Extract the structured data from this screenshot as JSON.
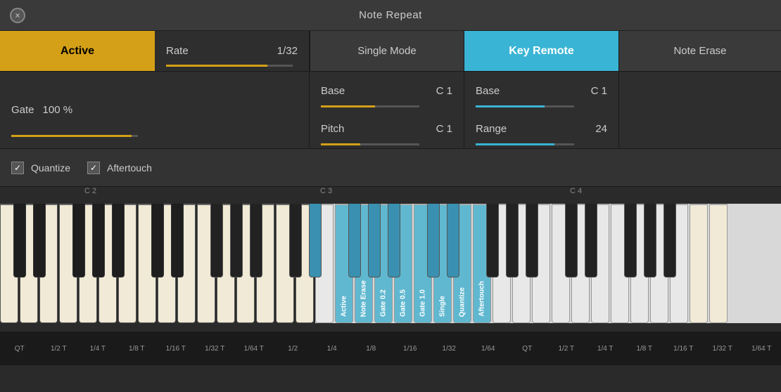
{
  "titleBar": {
    "title": "Note Repeat",
    "close": "×"
  },
  "controls": {
    "active": "Active",
    "rate_label": "Rate",
    "rate_value": "1/32",
    "single_mode": "Single Mode",
    "key_remote": "Key Remote",
    "note_erase": "Note Erase"
  },
  "params": {
    "gate_label": "Gate",
    "gate_value": "100 %",
    "single_mode": {
      "base_label": "Base",
      "base_value": "C 1",
      "pitch_label": "Pitch",
      "pitch_value": "C 1"
    },
    "key_remote": {
      "base_label": "Base",
      "base_value": "C 1",
      "range_label": "Range",
      "range_value": "24"
    }
  },
  "checkboxes": {
    "quantize": "Quantize",
    "aftertouch": "Aftertouch"
  },
  "noteLabels": {
    "c2": "C 2",
    "c3": "C 3",
    "c4": "C 4"
  },
  "keyLabels": {
    "highlighted": [
      "Active",
      "Note Erase",
      "Gate 0.2",
      "Gate 0.5",
      "Gate 1.0",
      "Single",
      "Quantize",
      "Aftertouch"
    ]
  },
  "bottomLabels": [
    "QT",
    "1/2 T",
    "1/4 T",
    "1/8 T",
    "1/16 T",
    "1/32 T",
    "1/64 T",
    "1/2",
    "1/4",
    "1/8",
    "1/16",
    "1/32",
    "1/64",
    "QT",
    "1/2 T",
    "1/4 T",
    "1/8 T",
    "1/16 T",
    "1/32 T",
    "1/64 T"
  ]
}
